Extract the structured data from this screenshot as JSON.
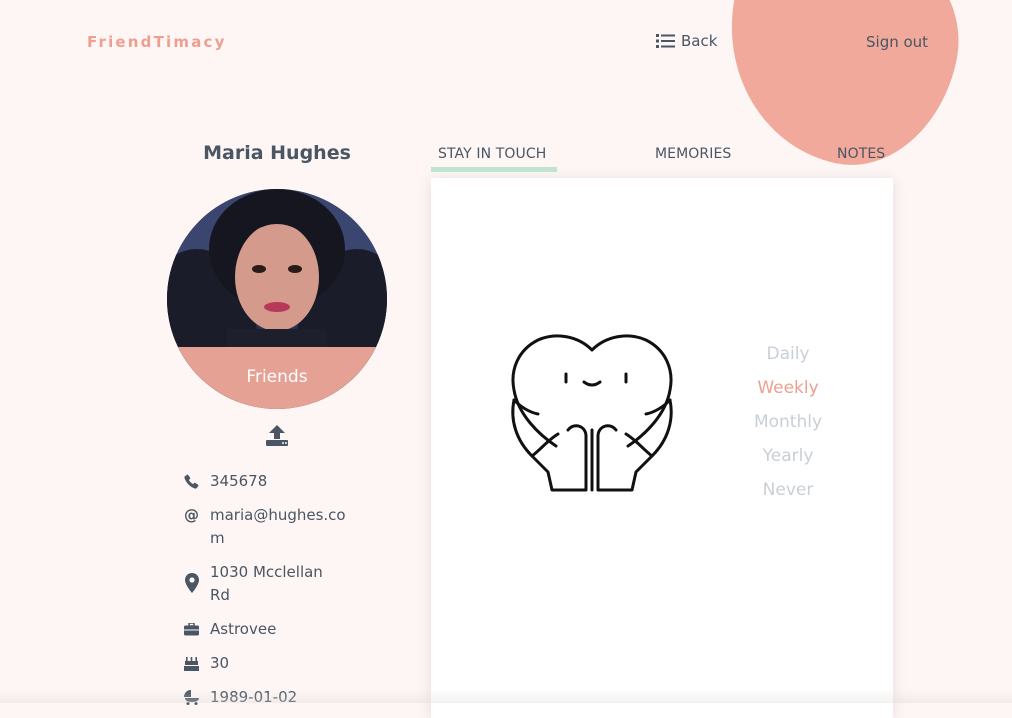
{
  "header": {
    "brand": "FriendTimacy",
    "back_label": "Back",
    "signout_label": "Sign out"
  },
  "profile": {
    "name": "Maria Hughes",
    "relationship": "Friends",
    "phone": "345678",
    "email": "maria@hughes.com",
    "address": "1030 Mcclellan Rd",
    "company": "Astrovee",
    "age": "30",
    "birthday": "1989-01-02"
  },
  "tabs": [
    {
      "label": "STAY IN TOUCH",
      "active": true
    },
    {
      "label": "MEMORIES",
      "active": false
    },
    {
      "label": "NOTES",
      "active": false
    }
  ],
  "frequency": {
    "options": [
      "Daily",
      "Weekly",
      "Monthly",
      "Yearly",
      "Never"
    ],
    "selected": "Weekly"
  },
  "colors": {
    "accent": "#ef9f91",
    "blob": "#f0a99b",
    "tab_underline": "#bfe4cf",
    "background": "#fdf6f4"
  },
  "icons": {
    "back": "list-icon",
    "upload": "upload-icon",
    "phone": "phone-icon",
    "email": "at-icon",
    "address": "map-marker-icon",
    "company": "briefcase-icon",
    "age": "birthday-cake-icon",
    "birthday": "baby-carriage-icon"
  }
}
